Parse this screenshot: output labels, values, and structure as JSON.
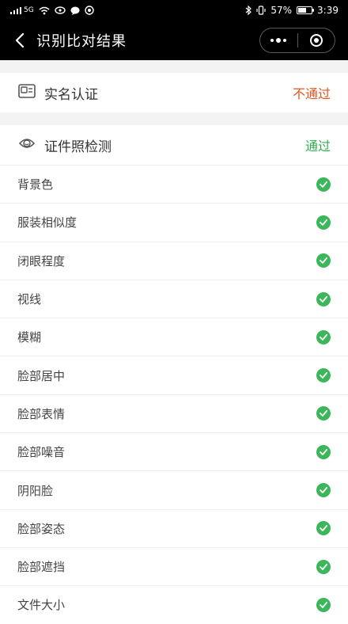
{
  "status_bar": {
    "network": "5G",
    "battery": "57%",
    "time": "3:39"
  },
  "nav": {
    "title": "识别比对结果"
  },
  "real_name": {
    "title": "实名认证",
    "status": "不通过",
    "status_color": "#e2551f"
  },
  "photo_check": {
    "title": "证件照检测",
    "status": "通过",
    "status_color": "#2eae4f",
    "items": [
      {
        "label": "背景色"
      },
      {
        "label": "服装相似度"
      },
      {
        "label": "闭眼程度"
      },
      {
        "label": "视线"
      },
      {
        "label": "模糊"
      },
      {
        "label": "脸部居中"
      },
      {
        "label": "脸部表情"
      },
      {
        "label": "脸部噪音"
      },
      {
        "label": "阴阳脸"
      },
      {
        "label": "脸部姿态"
      },
      {
        "label": "脸部遮挡"
      },
      {
        "label": "文件大小"
      }
    ]
  }
}
